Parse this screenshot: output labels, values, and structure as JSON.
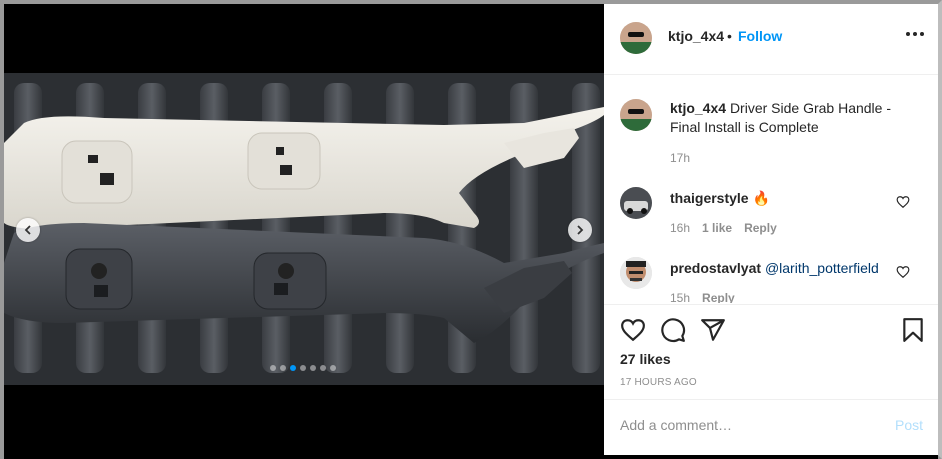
{
  "post": {
    "author": "ktjo_4x4",
    "follow_dot": "•",
    "follow_label": "Follow",
    "caption_user": "ktjo_4x4",
    "caption_text": "Driver Side Grab Handle - Final Install is Complete",
    "caption_time": "17h",
    "media_alt": "White and black driver side grab handle parts on truck bed liner"
  },
  "comments": [
    {
      "user": "thaigerstyle",
      "text": "🔥",
      "time": "16h",
      "likes": "1 like",
      "reply": "Reply"
    },
    {
      "user": "predostavlyat",
      "mention": "@larith_potterfield",
      "time": "15h",
      "reply": "Reply"
    }
  ],
  "actions": {
    "likes": "27 likes",
    "time_ago": "17 HOURS AGO",
    "add_comment_placeholder": "Add a comment…",
    "post_label": "Post"
  },
  "carousel": {
    "count": 7,
    "active_index": 2
  },
  "colors": {
    "accent": "#0095f6",
    "text": "#262626",
    "muted": "#8e8e8e",
    "post_disabled": "#b2dffc"
  }
}
